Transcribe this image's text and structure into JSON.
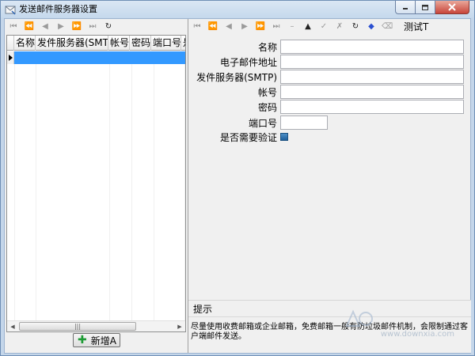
{
  "window": {
    "title": "发送邮件服务器设置"
  },
  "left_toolbar": {
    "icons": [
      "first-icon",
      "prev-page-icon",
      "prev-icon",
      "next-icon",
      "next-page-icon",
      "last-icon",
      "refresh-icon"
    ]
  },
  "grid": {
    "columns": [
      "名称",
      "发件服务器(SMTP)",
      "帐号",
      "密码",
      "端口号",
      "是"
    ],
    "rows": [
      [
        "",
        "",
        "",
        "",
        "",
        ""
      ]
    ]
  },
  "add_button": {
    "label": "新增A"
  },
  "right_toolbar": {
    "icons": [
      "first-icon",
      "prev-page-icon",
      "prev-icon",
      "next-icon",
      "next-page-icon",
      "last-icon",
      "minus-icon",
      "triangle-up-icon",
      "check-icon",
      "delete-icon",
      "refresh-icon",
      "tag-icon",
      "clear-icon"
    ],
    "test_label": "测试T"
  },
  "form": {
    "name_label": "名称",
    "email_label": "电子邮件地址",
    "smtp_label": "发件服务器(SMTP)",
    "account_label": "帐号",
    "password_label": "密码",
    "port_label": "端口号",
    "auth_label": "是否需要验证",
    "name_value": "",
    "email_value": "",
    "smtp_value": "",
    "account_value": "",
    "password_value": "",
    "port_value": ""
  },
  "hint": {
    "title": "提示",
    "text": "尽量使用收费邮箱或企业邮箱，免费邮箱一般有防垃圾邮件机制，会限制通过客户端邮件发送。"
  },
  "watermark": {
    "text": "www.downxia.com"
  }
}
